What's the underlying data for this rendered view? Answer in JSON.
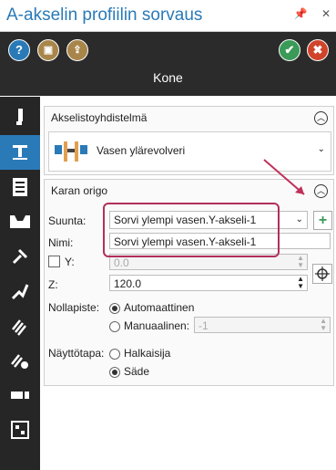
{
  "window": {
    "title": "A-akselin profiilin sorvaus",
    "pin_icon": "pin-icon",
    "close_icon": "close-icon"
  },
  "toolbar": {
    "subtitle": "Kone",
    "help": "?",
    "save": "save-icon",
    "export": "export-icon",
    "ok": "✔",
    "cancel": "✖"
  },
  "sidebar": {
    "items": [
      "tool-icon",
      "turret-icon",
      "list-icon",
      "stock-icon",
      "link-icon",
      "path-icon",
      "thread-icon",
      "settings-icon",
      "bar-icon",
      "grid-icon"
    ]
  },
  "axis_panel": {
    "title": "Akselistoyhdistelmä",
    "selected": "Vasen ylärevolveri"
  },
  "origin_panel": {
    "title": "Karan origo",
    "direction_label": "Suunta:",
    "direction_value": "Sorvi ylempi vasen.Y-akseli-1",
    "name_label": "Nimi:",
    "name_value": "Sorvi ylempi vasen.Y-akseli-1",
    "y_label": "Y:",
    "y_value": "0.0",
    "z_label": "Z:",
    "z_value": "120.0",
    "zero_label": "Nollapiste:",
    "zero_auto": "Automaattinen",
    "zero_manual": "Manuaalinen:",
    "zero_manual_value": "-1",
    "display_label": "Näyttötapa:",
    "display_diameter": "Halkaisija",
    "display_radius": "Säde"
  }
}
